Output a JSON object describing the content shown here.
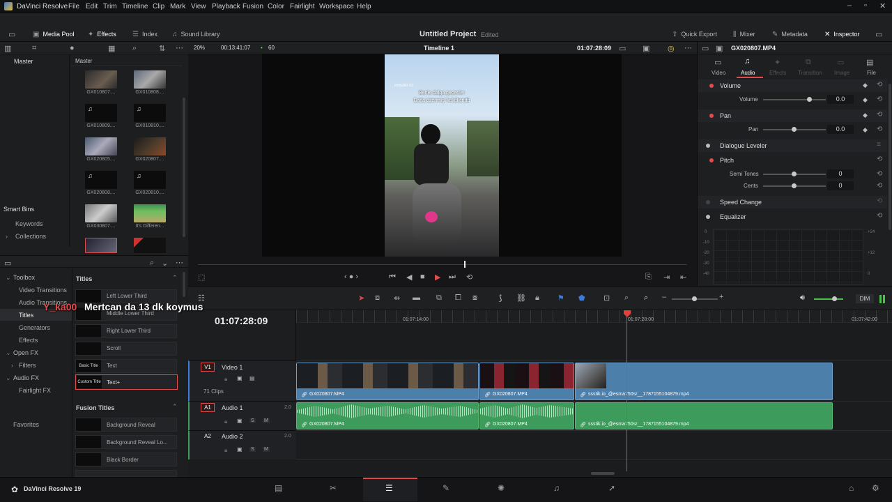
{
  "app": {
    "title": "DaVinci Resolve",
    "footer": "DaVinci Resolve 19"
  },
  "menu": [
    "File",
    "Edit",
    "Trim",
    "Timeline",
    "Clip",
    "Mark",
    "View",
    "Playback",
    "Fusion",
    "Color",
    "Fairlight",
    "Workspace",
    "Help"
  ],
  "toolbar": {
    "media_pool": "Media Pool",
    "effects": "Effects",
    "index": "Index",
    "sound_library": "Sound Library",
    "project_title": "Untitled Project",
    "edited": "Edited",
    "quick_export": "Quick Export",
    "mixer": "Mixer",
    "metadata": "Metadata",
    "inspector": "Inspector"
  },
  "media_pool": {
    "bin_master": "Master",
    "master_label": "Master",
    "clips": [
      "GX010807....",
      "GX010808....",
      "GX010809....",
      "GX010810....",
      "GX020805....",
      "GX020807....",
      "GX020808....",
      "GX020810....",
      "GX030807....",
      "It's Differen..."
    ],
    "smart_bins": "Smart Bins",
    "keywords": "Keywords",
    "collections": "Collections"
  },
  "effects": {
    "toolbox": "Toolbox",
    "video_transitions": "Video Transitions",
    "audio_transitions": "Audio Transitions",
    "titles": "Titles",
    "generators": "Generators",
    "effects": "Effects",
    "open_fx": "Open FX",
    "filters": "Filters",
    "audio_fx": "Audio FX",
    "fairlight_fx": "Fairlight FX",
    "favorites": "Favorites",
    "titles_header": "Titles",
    "title_items": [
      "Left Lower Third",
      "Middle Lower Third",
      "Right Lower Third",
      "Scroll",
      "Text",
      "Text+"
    ],
    "title_thumbs": [
      "",
      "",
      "",
      "",
      "Basic Title",
      "Custom Title"
    ],
    "fusion_titles_header": "Fusion Titles",
    "fusion_items": [
      "Background Reveal",
      "Background Reveal Lo...",
      "Black Border"
    ]
  },
  "viewer": {
    "zoom": "20%",
    "source_tc": "00:13:41:07",
    "fps": "60",
    "timeline_name": "Timeline 1",
    "record_tc": "01:07:28:09",
    "overlay_brand": "Insta360 X3",
    "overlay_line1": "Benle dalga geçenler",
    "overlay_line2": "Baha özenmiş' kckdkcndb"
  },
  "inspector": {
    "clip": "GX020807.MP4",
    "tabs": [
      "Video",
      "Audio",
      "Effects",
      "Transition",
      "Image",
      "File"
    ],
    "volume_header": "Volume",
    "volume_label": "Volume",
    "volume_value": "0.0",
    "pan_header": "Pan",
    "pan_label": "Pan",
    "pan_value": "0.0",
    "dialogue_leveler": "Dialogue Leveler",
    "pitch_header": "Pitch",
    "semi_tones": "Semi Tones",
    "semi_value": "0",
    "cents": "Cents",
    "cents_value": "0",
    "speed_change": "Speed Change",
    "equalizer": "Equalizer",
    "eq_left_scale": [
      "0",
      "-10",
      "-20",
      "-30",
      "-40"
    ],
    "eq_right_scale": [
      "+24",
      "+12",
      "0"
    ]
  },
  "timeline": {
    "timecode": "01:07:28:09",
    "ruler": [
      "01:07:14:00",
      "01:07:28:00",
      "01:07:42:00"
    ],
    "dim": "DIM",
    "v1_tag": "V1",
    "v1_name": "Video 1",
    "v1_clips": "71 Clips",
    "a1_tag": "A1",
    "a1_name": "Audio 1",
    "a1_level": "2.0",
    "a2_tag": "A2",
    "a2_name": "Audio 2",
    "a2_level": "2.0",
    "video_clips": [
      "GX020807.MP4",
      "GX020807.MP4",
      "ssstik.io_@esma750sr__1787155104879.mp4"
    ],
    "audio_clips": [
      "GX020807.MP4",
      "GX020807.MP4",
      "ssstik.io_@esma750sr__1787155104879.mp4"
    ]
  },
  "chat_overlay": {
    "user": "Y_ka00",
    "message": "Mertcan da 13 dk koymus"
  },
  "colors": {
    "accent": "#e14b4b",
    "clip_blue": "#4d7fab",
    "clip_green": "#3d9b5c",
    "playhead": "#e0413b"
  }
}
